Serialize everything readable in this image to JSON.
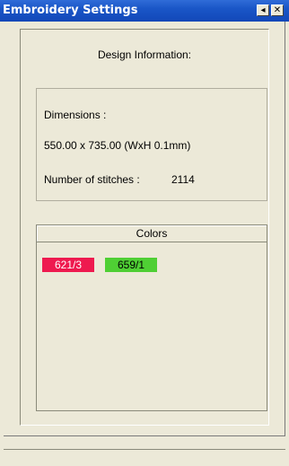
{
  "window": {
    "title": "Embroidery Settings",
    "pin_icon": "pin-icon",
    "close_icon": "close-icon",
    "pin_glyph": "◂",
    "close_glyph": "✕"
  },
  "design": {
    "heading": "Design Information:",
    "dimensions_label": "Dimensions :",
    "dimensions_value": "550.00 x 735.00 (WxH 0.1mm)",
    "stitches_label": "Number of stitches :",
    "stitches_value": "2114"
  },
  "colors": {
    "header": "Colors",
    "items": [
      {
        "code": "621/3",
        "color": "#ee1a4f"
      },
      {
        "code": "659/1",
        "color": "#4fcf34"
      }
    ]
  }
}
